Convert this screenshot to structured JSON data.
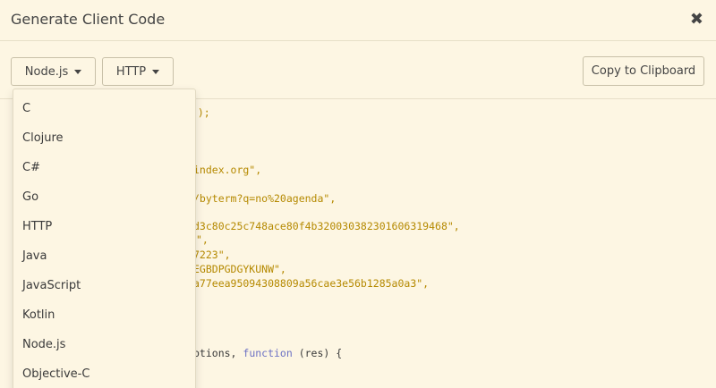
{
  "dialog": {
    "title": "Generate Client Code",
    "close_icon": "close-icon",
    "close_glyph": "✖"
  },
  "toolbar": {
    "language_selected": "Node.js",
    "variant_selected": "HTTP",
    "copy_label": "Copy to Clipboard"
  },
  "language_menu": {
    "items": [
      "C",
      "Clojure",
      "C#",
      "Go",
      "HTTP",
      "Java",
      "JavaScript",
      "Kotlin",
      "Node.js",
      "Objective-C"
    ]
  },
  "code_fragments": {
    "line1": "s\");",
    "line2": "index.org\",",
    "line3": "/byterm?q=no%20agenda\",",
    "line4": "d3c80c25c748ace80f4b32003038230160631946",
    "line4_tail": "8\",",
    "line5": "\",",
    "line6": "7223\",",
    "line7": "EGBDPGDGYKUNW\",",
    "line8": "a77eea95094308809a56cae3e56b1285a0a3\",",
    "line9_a": "ptions, ",
    "line9_kw": "function",
    "line9_b": " (res) {"
  }
}
